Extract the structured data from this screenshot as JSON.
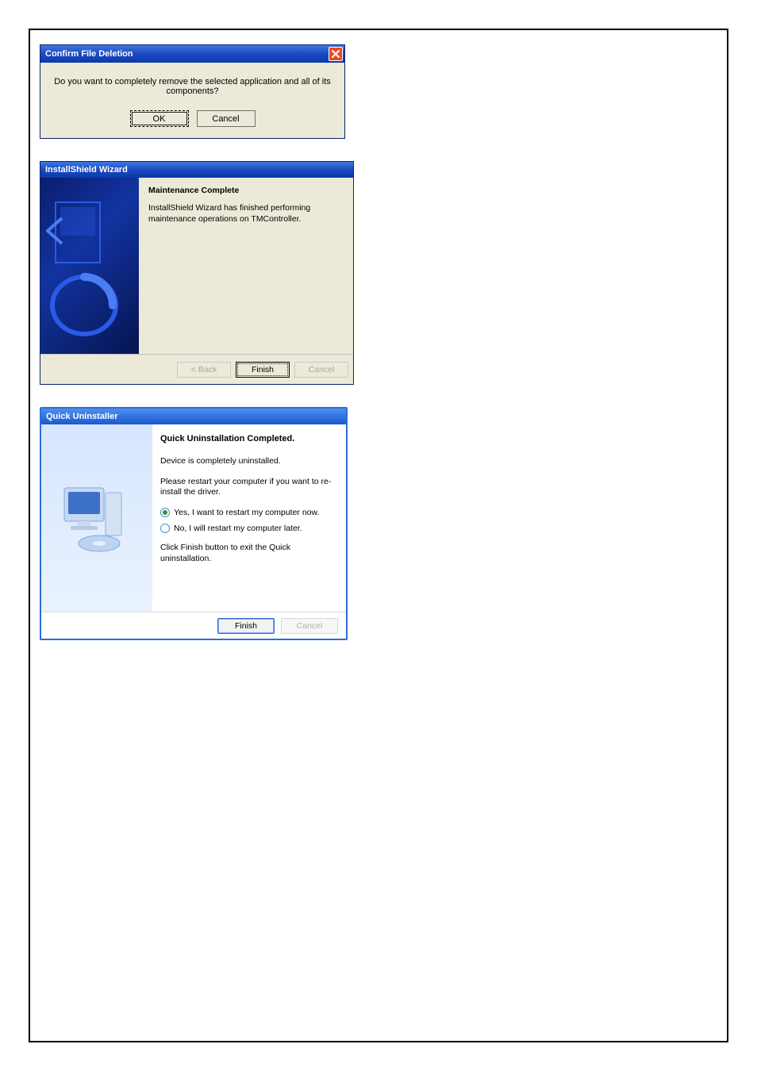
{
  "dlg1": {
    "title": "Confirm File Deletion",
    "message": "Do you want to completely remove the selected application and all of its components?",
    "ok_label": "OK",
    "cancel_label": "Cancel"
  },
  "dlg2": {
    "title": "InstallShield Wizard",
    "heading": "Maintenance Complete",
    "body": "InstallShield Wizard has finished performing maintenance operations on TMController.",
    "back_label": "< Back",
    "finish_label": "Finish",
    "cancel_label": "Cancel"
  },
  "dlg3": {
    "title": "Quick Uninstaller",
    "heading": "Quick Uninstallation Completed.",
    "line1": "Device is completely uninstalled.",
    "line2": "Please restart your computer if you want to re-install the driver.",
    "radio_yes": "Yes, I want to restart my computer now.",
    "radio_no": "No, I will restart my computer later.",
    "line3": "Click Finish button to exit the Quick uninstallation.",
    "finish_label": "Finish",
    "cancel_label": "Cancel",
    "selected_radio": "yes"
  }
}
